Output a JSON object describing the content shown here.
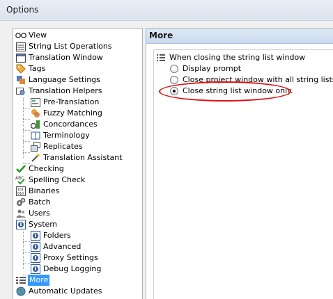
{
  "window": {
    "title": "Options"
  },
  "tree": {
    "items": [
      {
        "label": "View",
        "icon": "glasses-icon"
      },
      {
        "label": "String List Operations",
        "icon": "list-icon"
      },
      {
        "label": "Translation Window",
        "icon": "window-icon"
      },
      {
        "label": "Tags",
        "icon": "tag-icon"
      },
      {
        "label": "Language Settings",
        "icon": "language-settings-icon"
      },
      {
        "label": "Translation Helpers",
        "icon": "helpers-icon"
      },
      {
        "label": "Pre-Translation",
        "icon": "pretranslation-icon"
      },
      {
        "label": "Fuzzy Matching",
        "icon": "fuzzy-icon"
      },
      {
        "label": "Concordances",
        "icon": "concordances-icon"
      },
      {
        "label": "Terminology",
        "icon": "book-icon"
      },
      {
        "label": "Replicates",
        "icon": "replicates-icon"
      },
      {
        "label": "Translation Assistant",
        "icon": "wand-icon"
      },
      {
        "label": "Checking",
        "icon": "checkmark-icon"
      },
      {
        "label": "Spelling Check",
        "icon": "spelling-icon"
      },
      {
        "label": "Binaries",
        "icon": "binaries-icon"
      },
      {
        "label": "Batch",
        "icon": "gears-icon"
      },
      {
        "label": "Users",
        "icon": "users-icon"
      },
      {
        "label": "System",
        "icon": "system-icon"
      },
      {
        "label": "Folders",
        "icon": "system-icon"
      },
      {
        "label": "Advanced",
        "icon": "system-icon"
      },
      {
        "label": "Proxy Settings",
        "icon": "system-icon"
      },
      {
        "label": "Debug Logging",
        "icon": "system-icon"
      },
      {
        "label": "More",
        "icon": "more-icon",
        "selected": true
      },
      {
        "label": "Automatic Updates",
        "icon": "globe-icon"
      }
    ]
  },
  "panel": {
    "title": "More",
    "group_label": "When closing the string list window",
    "options": [
      {
        "label": "Display prompt",
        "checked": false
      },
      {
        "label": "Close project window with all string lists.",
        "checked": false
      },
      {
        "label": "Close string list window only.",
        "checked": true
      }
    ]
  },
  "colors": {
    "selection": "#3399ff",
    "highlight_ellipse": "#e01010",
    "header_gradient_top": "#dfe9f5"
  }
}
